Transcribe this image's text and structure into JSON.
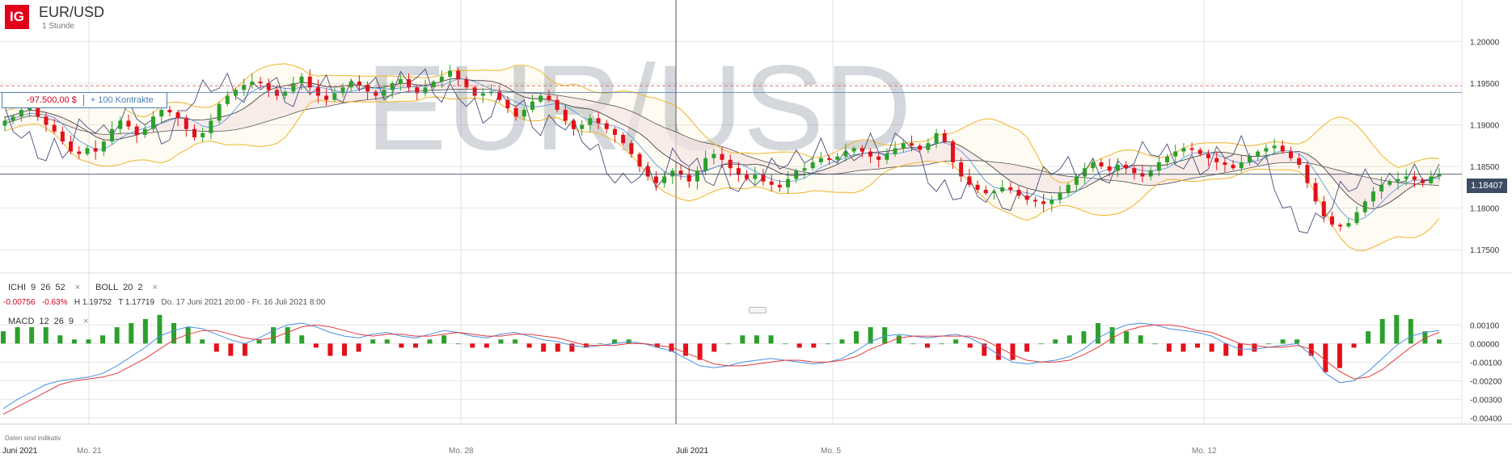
{
  "header": {
    "logo": "IG",
    "symbol": "EUR/USD",
    "interval": "1 Stunde",
    "watermark": "EUR/USD"
  },
  "position": {
    "pl": "-97.500,00 $",
    "contracts": "+ 100 Kontrakte"
  },
  "indicators": {
    "ichi": {
      "name": "ICHI",
      "p1": "9",
      "p2": "26",
      "p3": "52",
      "remove": "×"
    },
    "boll": {
      "name": "BOLL",
      "p1": "20",
      "p2": "2",
      "remove": "×"
    },
    "macd": {
      "name": "MACD",
      "p1": "12",
      "p2": "26",
      "p3": "9",
      "remove": "×"
    }
  },
  "stats": {
    "change": "-0.00756",
    "change_pct": "-0.63%",
    "high_label": "H",
    "high": "1.19752",
    "low_label": "T",
    "low": "1.17719",
    "range": "Do. 17 Juni 2021 20:00 - Fr. 16 Juli 2021 8:00"
  },
  "disclaimer": "Daten sind indikativ",
  "current_price": "1.18407",
  "colors": {
    "up": "#2ca02c",
    "down": "#e3101a",
    "ichimoku_line": "#4a4a7a",
    "bollinger": "#f0b429",
    "macd_line": "#4a90e2",
    "signal_line": "#e33b3b",
    "cloud": "#f5e6e6"
  },
  "chart_data": [
    {
      "type": "candlestick",
      "title": "EUR/USD",
      "y_axis_ticks": [
        "1.20000",
        "1.19500",
        "1.19000",
        "1.18500",
        "1.18000",
        "1.17500"
      ],
      "ylim": [
        1.1722,
        1.205
      ],
      "x_axis_labels": [
        "Juni 2021",
        "Mo. 21",
        "Mo. 28",
        "Juli 2021",
        "Mo. 5",
        "Mo. 12"
      ],
      "horizontal_lines": [
        {
          "name": "entry",
          "value": 1.1947,
          "style": "dashed"
        },
        {
          "name": "position",
          "value": 1.1939,
          "style": "solid"
        },
        {
          "name": "current",
          "value": 1.18407,
          "style": "solid"
        }
      ],
      "closes": [
        1.1905,
        1.191,
        1.1918,
        1.1922,
        1.191,
        1.19,
        1.1892,
        1.188,
        1.1868,
        1.1865,
        1.1872,
        1.1868,
        1.188,
        1.1895,
        1.1905,
        1.1898,
        1.1888,
        1.1895,
        1.191,
        1.1918,
        1.1915,
        1.1908,
        1.1895,
        1.1885,
        1.189,
        1.1905,
        1.1925,
        1.1935,
        1.1942,
        1.1948,
        1.1952,
        1.195,
        1.1942,
        1.1935,
        1.194,
        1.195,
        1.1958,
        1.1945,
        1.1935,
        1.193,
        1.1938,
        1.1945,
        1.1952,
        1.1948,
        1.194,
        1.1935,
        1.1942,
        1.195,
        1.1955,
        1.1945,
        1.1938,
        1.1945,
        1.1952,
        1.1958,
        1.1965,
        1.1955,
        1.1945,
        1.1935,
        1.1938,
        1.194,
        1.193,
        1.192,
        1.191,
        1.1918,
        1.1928,
        1.1935,
        1.193,
        1.1918,
        1.1905,
        1.1895,
        1.19,
        1.1908,
        1.1902,
        1.1895,
        1.1888,
        1.1878,
        1.1865,
        1.185,
        1.1838,
        1.183,
        1.1838,
        1.1845,
        1.184,
        1.1832,
        1.1845,
        1.186,
        1.1865,
        1.1858,
        1.1848,
        1.184,
        1.1835,
        1.184,
        1.1832,
        1.1828,
        1.1825,
        1.1835,
        1.1845,
        1.1848,
        1.1855,
        1.186,
        1.1858,
        1.1862,
        1.1868,
        1.1872,
        1.1868,
        1.1862,
        1.1858,
        1.1865,
        1.1872,
        1.1878,
        1.1875,
        1.187,
        1.1878,
        1.189,
        1.188,
        1.1855,
        1.1838,
        1.1828,
        1.1822,
        1.1818,
        1.182,
        1.1825,
        1.1822,
        1.1815,
        1.181,
        1.1808,
        1.1805,
        1.181,
        1.1818,
        1.1828,
        1.1838,
        1.1848,
        1.1855,
        1.185,
        1.1845,
        1.1852,
        1.1848,
        1.1842,
        1.1838,
        1.1845,
        1.1855,
        1.1862,
        1.1868,
        1.1872,
        1.187,
        1.1865,
        1.186,
        1.1855,
        1.1852,
        1.1848,
        1.1855,
        1.1862,
        1.1868,
        1.1872,
        1.1875,
        1.1868,
        1.186,
        1.1852,
        1.183,
        1.1808,
        1.179,
        1.178,
        1.1778,
        1.1782,
        1.1795,
        1.1808,
        1.182,
        1.1828,
        1.1832,
        1.1835,
        1.1838,
        1.1834,
        1.183,
        1.1838,
        1.1841
      ]
    },
    {
      "type": "macd",
      "title": "MACD 12 26 9",
      "y_axis_ticks": [
        "0.00100",
        "0.00000",
        "-0.00100",
        "-0.00200",
        "-0.00300",
        "-0.00400"
      ],
      "ylim": [
        -0.0042,
        0.0011
      ],
      "series": [
        {
          "name": "MACD",
          "values": [
            -0.0035,
            -0.003,
            -0.0026,
            -0.0022,
            -0.002,
            -0.0019,
            -0.0018,
            -0.0016,
            -0.0012,
            -0.0007,
            -0.0002,
            0.0004,
            0.0007,
            0.0009,
            0.0008,
            0.0005,
            0.0002,
            0.0,
            0.0003,
            0.0007,
            0.001,
            0.0011,
            0.0009,
            0.0006,
            0.0004,
            0.0003,
            0.0005,
            0.0006,
            0.0004,
            0.0003,
            0.0005,
            0.0007,
            0.0006,
            0.0004,
            0.0003,
            0.0005,
            0.0006,
            0.0004,
            0.0002,
            0.0001,
            -0.0001,
            -0.0002,
            -0.0001,
            0.0,
            0.0001,
            0.0,
            -0.0002,
            -0.0004,
            -0.0008,
            -0.0012,
            -0.0013,
            -0.0012,
            -0.001,
            -0.0009,
            -0.0008,
            -0.0009,
            -0.001,
            -0.0011,
            -0.001,
            -0.0008,
            -0.0004,
            0.0001,
            0.0004,
            0.0005,
            0.0004,
            0.0003,
            0.0004,
            0.0005,
            0.0003,
            -0.0001,
            -0.0006,
            -0.001,
            -0.0011,
            -0.001,
            -0.0009,
            -0.0007,
            -0.0003,
            0.0003,
            0.0007,
            0.001,
            0.0011,
            0.001,
            0.0008,
            0.0007,
            0.0006,
            0.0004,
            0.0,
            -0.0003,
            -0.0003,
            -0.0002,
            -0.0001,
            0.0,
            -0.0006,
            -0.0016,
            -0.0021,
            -0.002,
            -0.0015,
            -0.0008,
            -0.0001,
            0.0004,
            0.0006,
            0.0007
          ]
        },
        {
          "name": "Signal",
          "values": [
            -0.0038,
            -0.0034,
            -0.003,
            -0.0026,
            -0.0022,
            -0.002,
            -0.0019,
            -0.0018,
            -0.0016,
            -0.0012,
            -0.0008,
            -0.0003,
            0.0002,
            0.0005,
            0.0007,
            0.0007,
            0.0005,
            0.0003,
            0.0002,
            0.0003,
            0.0006,
            0.0009,
            0.001,
            0.0009,
            0.0007,
            0.0005,
            0.0004,
            0.0005,
            0.0005,
            0.0004,
            0.0004,
            0.0005,
            0.0006,
            0.0005,
            0.0004,
            0.0004,
            0.0005,
            0.0005,
            0.0004,
            0.0003,
            0.0001,
            -0.0001,
            -0.0001,
            -0.0001,
            0.0,
            0.0,
            -0.0001,
            -0.0002,
            -0.0005,
            -0.0008,
            -0.0011,
            -0.0012,
            -0.0012,
            -0.0011,
            -0.001,
            -0.0009,
            -0.0009,
            -0.001,
            -0.001,
            -0.0009,
            -0.0007,
            -0.0003,
            0.0,
            0.0003,
            0.0004,
            0.0004,
            0.0004,
            0.0004,
            0.0004,
            0.0002,
            -0.0002,
            -0.0006,
            -0.0009,
            -0.001,
            -0.001,
            -0.0009,
            -0.0006,
            -0.0002,
            0.0003,
            0.0007,
            0.0009,
            0.001,
            0.001,
            0.0009,
            0.0007,
            0.0006,
            0.0003,
            0.0,
            -0.0001,
            -0.0002,
            -0.0002,
            -0.0001,
            -0.0003,
            -0.0009,
            -0.0015,
            -0.0019,
            -0.0018,
            -0.0014,
            -0.0008,
            -0.0002,
            0.0003,
            0.0006
          ]
        }
      ]
    }
  ]
}
